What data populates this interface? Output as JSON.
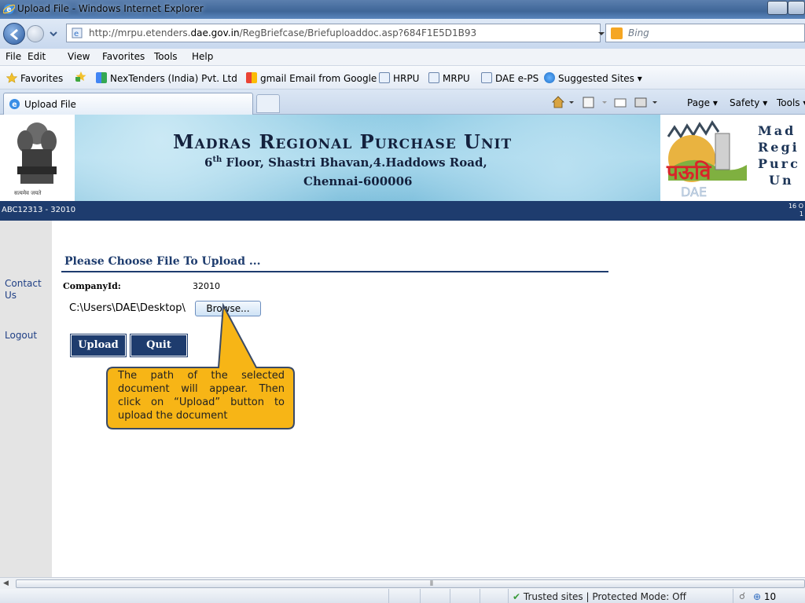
{
  "window": {
    "title": "Upload File - Windows Internet Explorer"
  },
  "address": {
    "url_prefix": "http://mrpu.etenders.",
    "url_domain": "dae.gov.in",
    "url_rest": "/RegBriefcase/Briefuploaddoc.asp?684F1E5D1B93",
    "search_placeholder": "Bing"
  },
  "menu": [
    "File",
    "Edit",
    "View",
    "Favorites",
    "Tools",
    "Help"
  ],
  "favorites": {
    "label": "Favorites",
    "items": [
      "NexTenders (India) Pvt. Ltd",
      "gmail Email from Google",
      "HRPU",
      "MRPU",
      "DAE e-PS",
      "Suggested Sites ▾"
    ]
  },
  "tab": {
    "label": "Upload File"
  },
  "commandbar": {
    "page": "Page ▾",
    "safety": "Safety ▾",
    "tools": "Tools ▾"
  },
  "banner": {
    "title": "Madras Regional Purchase Unit",
    "address_floor": "6",
    "address_floor_sup": "th",
    "address_rest": " Floor, Shastri Bhavan,4.Haddows Road,",
    "city": "Chennai-600006",
    "emblem_caption": "सत्यमेव जयते",
    "logo_text": "पऊवि",
    "logo_sub": "DAE",
    "side_lines": [
      "Mad",
      "Regi",
      "Purc",
      "Un"
    ]
  },
  "strip": {
    "left": "ABC12313 - 32010",
    "right_line1": "16 O",
    "right_line2": "1"
  },
  "sidebar": {
    "contact": "Contact Us",
    "logout": "Logout"
  },
  "form": {
    "heading": "Please Choose File To Upload ...",
    "company_label": "CompanyId:",
    "company_value": "32010",
    "file_value": "C:\\Users\\DAE\\Desktop\\",
    "browse_label": "Browse...",
    "upload_label": "Upload",
    "quit_label": "Quit"
  },
  "callout": {
    "text": "The path of the selected document will appear. Then click on “Upload” button to upload the document",
    "fill": "#f7b516",
    "stroke": "#3a4a66"
  },
  "statusbar": {
    "zone": "Trusted sites | Protected Mode: Off",
    "zoom": "10"
  },
  "colors": {
    "navy": "#1e3c6e",
    "link": "#1f3f85"
  }
}
